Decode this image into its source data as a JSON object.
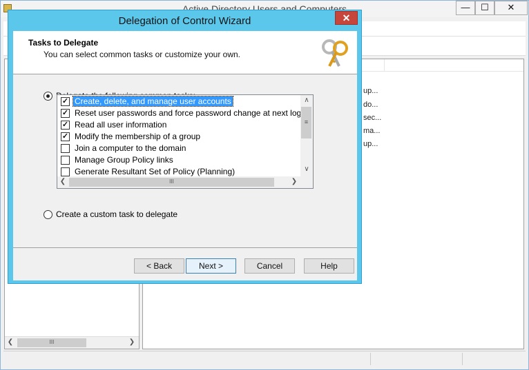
{
  "background_window": {
    "title": "Active Directory Users and Computers",
    "min_symbol": "—",
    "max_symbol": "☐",
    "close_symbol": "✕",
    "descriptions": [
      "up...",
      "do...",
      "sec...",
      "ma...",
      "up..."
    ],
    "hscroll_thumb": "III"
  },
  "wizard": {
    "title": "Delegation of Control Wizard",
    "close_symbol": "✕",
    "header": {
      "title": "Tasks to Delegate",
      "subtitle": "You can select common tasks or customize your own.",
      "icon": "keys-icon"
    },
    "option_common_label": "Delegate the following common tasks:",
    "option_common_selected": true,
    "option_custom_label": "Create a custom task to delegate",
    "option_custom_selected": false,
    "tasks": [
      {
        "label": "Create, delete, and manage user accounts",
        "checked": true,
        "selected": true
      },
      {
        "label": "Reset user passwords and force password change at next logon",
        "checked": true,
        "selected": false
      },
      {
        "label": "Read all user information",
        "checked": true,
        "selected": false
      },
      {
        "label": "Modify the membership of a group",
        "checked": true,
        "selected": false
      },
      {
        "label": "Join a computer to the domain",
        "checked": false,
        "selected": false
      },
      {
        "label": "Manage Group Policy links",
        "checked": false,
        "selected": false
      },
      {
        "label": "Generate Resultant Set of Policy (Planning)",
        "checked": false,
        "selected": false
      }
    ],
    "scroll_grip": "III",
    "buttons": {
      "back": "< Back",
      "next": "Next >",
      "cancel": "Cancel",
      "help": "Help"
    }
  },
  "colors": {
    "dialog_frame": "#5bc7ea",
    "selection": "#3399ff",
    "close_button": "#c7463b"
  }
}
